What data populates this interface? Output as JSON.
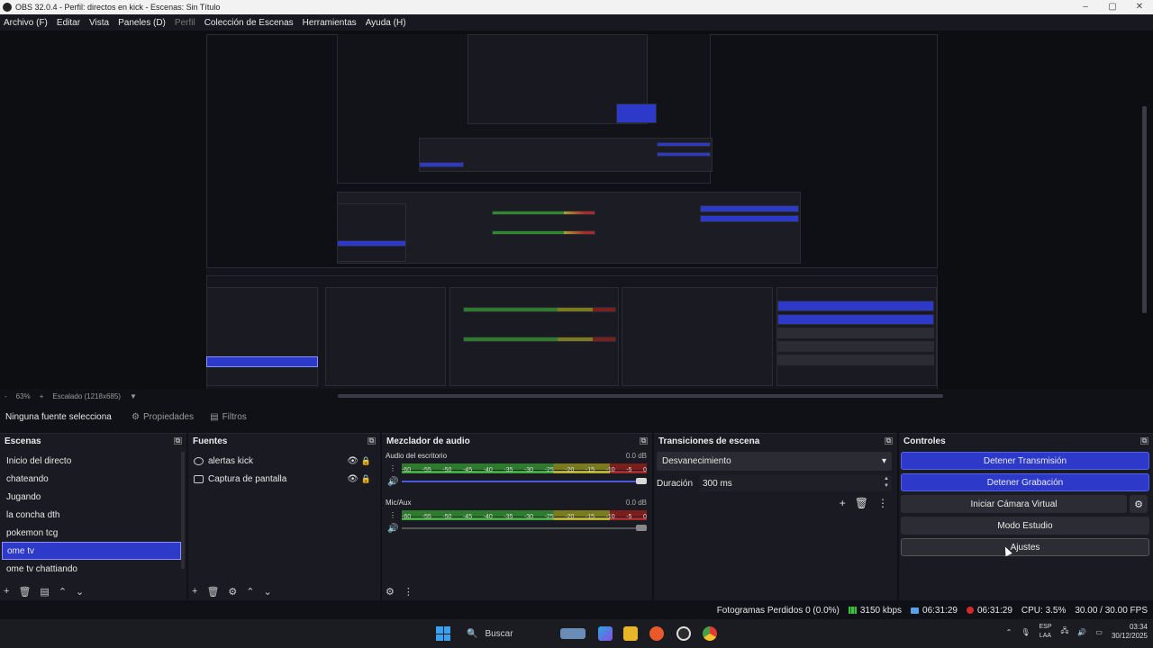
{
  "window": {
    "title": "OBS 32.0.4 - Perfil: directos en kick - Escenas: Sin Título",
    "controls": [
      "–",
      "▢",
      "✕"
    ]
  },
  "menu": [
    {
      "label": "Archivo (F)",
      "dim": false
    },
    {
      "label": "Editar",
      "dim": false
    },
    {
      "label": "Vista",
      "dim": false
    },
    {
      "label": "Paneles (D)",
      "dim": false
    },
    {
      "label": "Perfil",
      "dim": true
    },
    {
      "label": "Colección de Escenas",
      "dim": false
    },
    {
      "label": "Herramientas",
      "dim": false
    },
    {
      "label": "Ayuda (H)",
      "dim": false
    }
  ],
  "zoom": {
    "minus": "-",
    "value": "63%",
    "plus": "+",
    "scale": "Escalado (1218x685)"
  },
  "source_bar": {
    "no_source": "Ninguna fuente seleccionada",
    "properties": "Propiedades",
    "filters": "Filtros"
  },
  "scenes": {
    "title": "Escenas",
    "items": [
      "Inicio del directo",
      "chateando",
      "Jugando",
      "la concha dth",
      "pokemon tcg",
      "ome tv",
      "ome tv chattiando"
    ],
    "selected_index": 5
  },
  "sources": {
    "title": "Fuentes",
    "items": [
      {
        "label": "alertas kick",
        "icon": "browser-icon"
      },
      {
        "label": "Captura de pantalla",
        "icon": "monitor-icon"
      }
    ]
  },
  "mixer": {
    "title": "Mezclador de audio",
    "ticks": [
      "-60",
      "-55",
      "-50",
      "-45",
      "-40",
      "-35",
      "-30",
      "-25",
      "-20",
      "-15",
      "-10",
      "-5",
      "0"
    ],
    "channels": [
      {
        "name": "Audio del escritorio",
        "db": "0.0 dB",
        "volume": 1.0,
        "muted": false
      },
      {
        "name": "Mic/Aux",
        "db": "0.0 dB",
        "volume": 1.0,
        "muted": true
      }
    ]
  },
  "transitions": {
    "title": "Transiciones de escena",
    "selected": "Desvanecimiento",
    "duration_label": "Duración",
    "duration_value": "300 ms"
  },
  "controls": {
    "title": "Controles",
    "stop_stream": "Detener Transmisión",
    "stop_record": "Detener Grabación",
    "virtual_cam": "Iniciar Cámara Virtual",
    "studio_mode": "Modo Estudio",
    "settings": "Ajustes"
  },
  "status": {
    "dropped": "Fotogramas Perdidos 0 (0.0%)",
    "bitrate": "3150 kbps",
    "stream_time": "06:31:29",
    "record_time": "06:31:29",
    "cpu": "CPU: 3.5%",
    "fps": "30.00 / 30.00 FPS"
  },
  "taskbar": {
    "search": "Buscar",
    "lang1": "ESP",
    "lang2": "LAA",
    "time": "03:34",
    "date": "30/12/2025"
  },
  "colors": {
    "accent": "#2d39c9",
    "background": "#1a1b22",
    "record": "#d52a2a"
  }
}
